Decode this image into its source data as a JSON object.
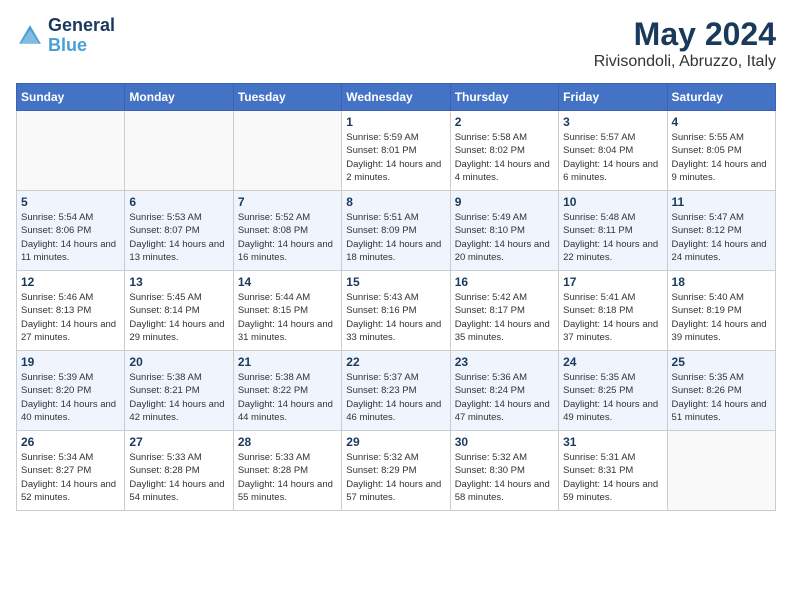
{
  "header": {
    "logo_line1": "General",
    "logo_line2": "Blue",
    "title": "May 2024",
    "subtitle": "Rivisondoli, Abruzzo, Italy"
  },
  "weekdays": [
    "Sunday",
    "Monday",
    "Tuesday",
    "Wednesday",
    "Thursday",
    "Friday",
    "Saturday"
  ],
  "weeks": [
    [
      {
        "day": "",
        "sunrise": "",
        "sunset": "",
        "daylight": ""
      },
      {
        "day": "",
        "sunrise": "",
        "sunset": "",
        "daylight": ""
      },
      {
        "day": "",
        "sunrise": "",
        "sunset": "",
        "daylight": ""
      },
      {
        "day": "1",
        "sunrise": "Sunrise: 5:59 AM",
        "sunset": "Sunset: 8:01 PM",
        "daylight": "Daylight: 14 hours and 2 minutes."
      },
      {
        "day": "2",
        "sunrise": "Sunrise: 5:58 AM",
        "sunset": "Sunset: 8:02 PM",
        "daylight": "Daylight: 14 hours and 4 minutes."
      },
      {
        "day": "3",
        "sunrise": "Sunrise: 5:57 AM",
        "sunset": "Sunset: 8:04 PM",
        "daylight": "Daylight: 14 hours and 6 minutes."
      },
      {
        "day": "4",
        "sunrise": "Sunrise: 5:55 AM",
        "sunset": "Sunset: 8:05 PM",
        "daylight": "Daylight: 14 hours and 9 minutes."
      }
    ],
    [
      {
        "day": "5",
        "sunrise": "Sunrise: 5:54 AM",
        "sunset": "Sunset: 8:06 PM",
        "daylight": "Daylight: 14 hours and 11 minutes."
      },
      {
        "day": "6",
        "sunrise": "Sunrise: 5:53 AM",
        "sunset": "Sunset: 8:07 PM",
        "daylight": "Daylight: 14 hours and 13 minutes."
      },
      {
        "day": "7",
        "sunrise": "Sunrise: 5:52 AM",
        "sunset": "Sunset: 8:08 PM",
        "daylight": "Daylight: 14 hours and 16 minutes."
      },
      {
        "day": "8",
        "sunrise": "Sunrise: 5:51 AM",
        "sunset": "Sunset: 8:09 PM",
        "daylight": "Daylight: 14 hours and 18 minutes."
      },
      {
        "day": "9",
        "sunrise": "Sunrise: 5:49 AM",
        "sunset": "Sunset: 8:10 PM",
        "daylight": "Daylight: 14 hours and 20 minutes."
      },
      {
        "day": "10",
        "sunrise": "Sunrise: 5:48 AM",
        "sunset": "Sunset: 8:11 PM",
        "daylight": "Daylight: 14 hours and 22 minutes."
      },
      {
        "day": "11",
        "sunrise": "Sunrise: 5:47 AM",
        "sunset": "Sunset: 8:12 PM",
        "daylight": "Daylight: 14 hours and 24 minutes."
      }
    ],
    [
      {
        "day": "12",
        "sunrise": "Sunrise: 5:46 AM",
        "sunset": "Sunset: 8:13 PM",
        "daylight": "Daylight: 14 hours and 27 minutes."
      },
      {
        "day": "13",
        "sunrise": "Sunrise: 5:45 AM",
        "sunset": "Sunset: 8:14 PM",
        "daylight": "Daylight: 14 hours and 29 minutes."
      },
      {
        "day": "14",
        "sunrise": "Sunrise: 5:44 AM",
        "sunset": "Sunset: 8:15 PM",
        "daylight": "Daylight: 14 hours and 31 minutes."
      },
      {
        "day": "15",
        "sunrise": "Sunrise: 5:43 AM",
        "sunset": "Sunset: 8:16 PM",
        "daylight": "Daylight: 14 hours and 33 minutes."
      },
      {
        "day": "16",
        "sunrise": "Sunrise: 5:42 AM",
        "sunset": "Sunset: 8:17 PM",
        "daylight": "Daylight: 14 hours and 35 minutes."
      },
      {
        "day": "17",
        "sunrise": "Sunrise: 5:41 AM",
        "sunset": "Sunset: 8:18 PM",
        "daylight": "Daylight: 14 hours and 37 minutes."
      },
      {
        "day": "18",
        "sunrise": "Sunrise: 5:40 AM",
        "sunset": "Sunset: 8:19 PM",
        "daylight": "Daylight: 14 hours and 39 minutes."
      }
    ],
    [
      {
        "day": "19",
        "sunrise": "Sunrise: 5:39 AM",
        "sunset": "Sunset: 8:20 PM",
        "daylight": "Daylight: 14 hours and 40 minutes."
      },
      {
        "day": "20",
        "sunrise": "Sunrise: 5:38 AM",
        "sunset": "Sunset: 8:21 PM",
        "daylight": "Daylight: 14 hours and 42 minutes."
      },
      {
        "day": "21",
        "sunrise": "Sunrise: 5:38 AM",
        "sunset": "Sunset: 8:22 PM",
        "daylight": "Daylight: 14 hours and 44 minutes."
      },
      {
        "day": "22",
        "sunrise": "Sunrise: 5:37 AM",
        "sunset": "Sunset: 8:23 PM",
        "daylight": "Daylight: 14 hours and 46 minutes."
      },
      {
        "day": "23",
        "sunrise": "Sunrise: 5:36 AM",
        "sunset": "Sunset: 8:24 PM",
        "daylight": "Daylight: 14 hours and 47 minutes."
      },
      {
        "day": "24",
        "sunrise": "Sunrise: 5:35 AM",
        "sunset": "Sunset: 8:25 PM",
        "daylight": "Daylight: 14 hours and 49 minutes."
      },
      {
        "day": "25",
        "sunrise": "Sunrise: 5:35 AM",
        "sunset": "Sunset: 8:26 PM",
        "daylight": "Daylight: 14 hours and 51 minutes."
      }
    ],
    [
      {
        "day": "26",
        "sunrise": "Sunrise: 5:34 AM",
        "sunset": "Sunset: 8:27 PM",
        "daylight": "Daylight: 14 hours and 52 minutes."
      },
      {
        "day": "27",
        "sunrise": "Sunrise: 5:33 AM",
        "sunset": "Sunset: 8:28 PM",
        "daylight": "Daylight: 14 hours and 54 minutes."
      },
      {
        "day": "28",
        "sunrise": "Sunrise: 5:33 AM",
        "sunset": "Sunset: 8:28 PM",
        "daylight": "Daylight: 14 hours and 55 minutes."
      },
      {
        "day": "29",
        "sunrise": "Sunrise: 5:32 AM",
        "sunset": "Sunset: 8:29 PM",
        "daylight": "Daylight: 14 hours and 57 minutes."
      },
      {
        "day": "30",
        "sunrise": "Sunrise: 5:32 AM",
        "sunset": "Sunset: 8:30 PM",
        "daylight": "Daylight: 14 hours and 58 minutes."
      },
      {
        "day": "31",
        "sunrise": "Sunrise: 5:31 AM",
        "sunset": "Sunset: 8:31 PM",
        "daylight": "Daylight: 14 hours and 59 minutes."
      },
      {
        "day": "",
        "sunrise": "",
        "sunset": "",
        "daylight": ""
      }
    ]
  ]
}
